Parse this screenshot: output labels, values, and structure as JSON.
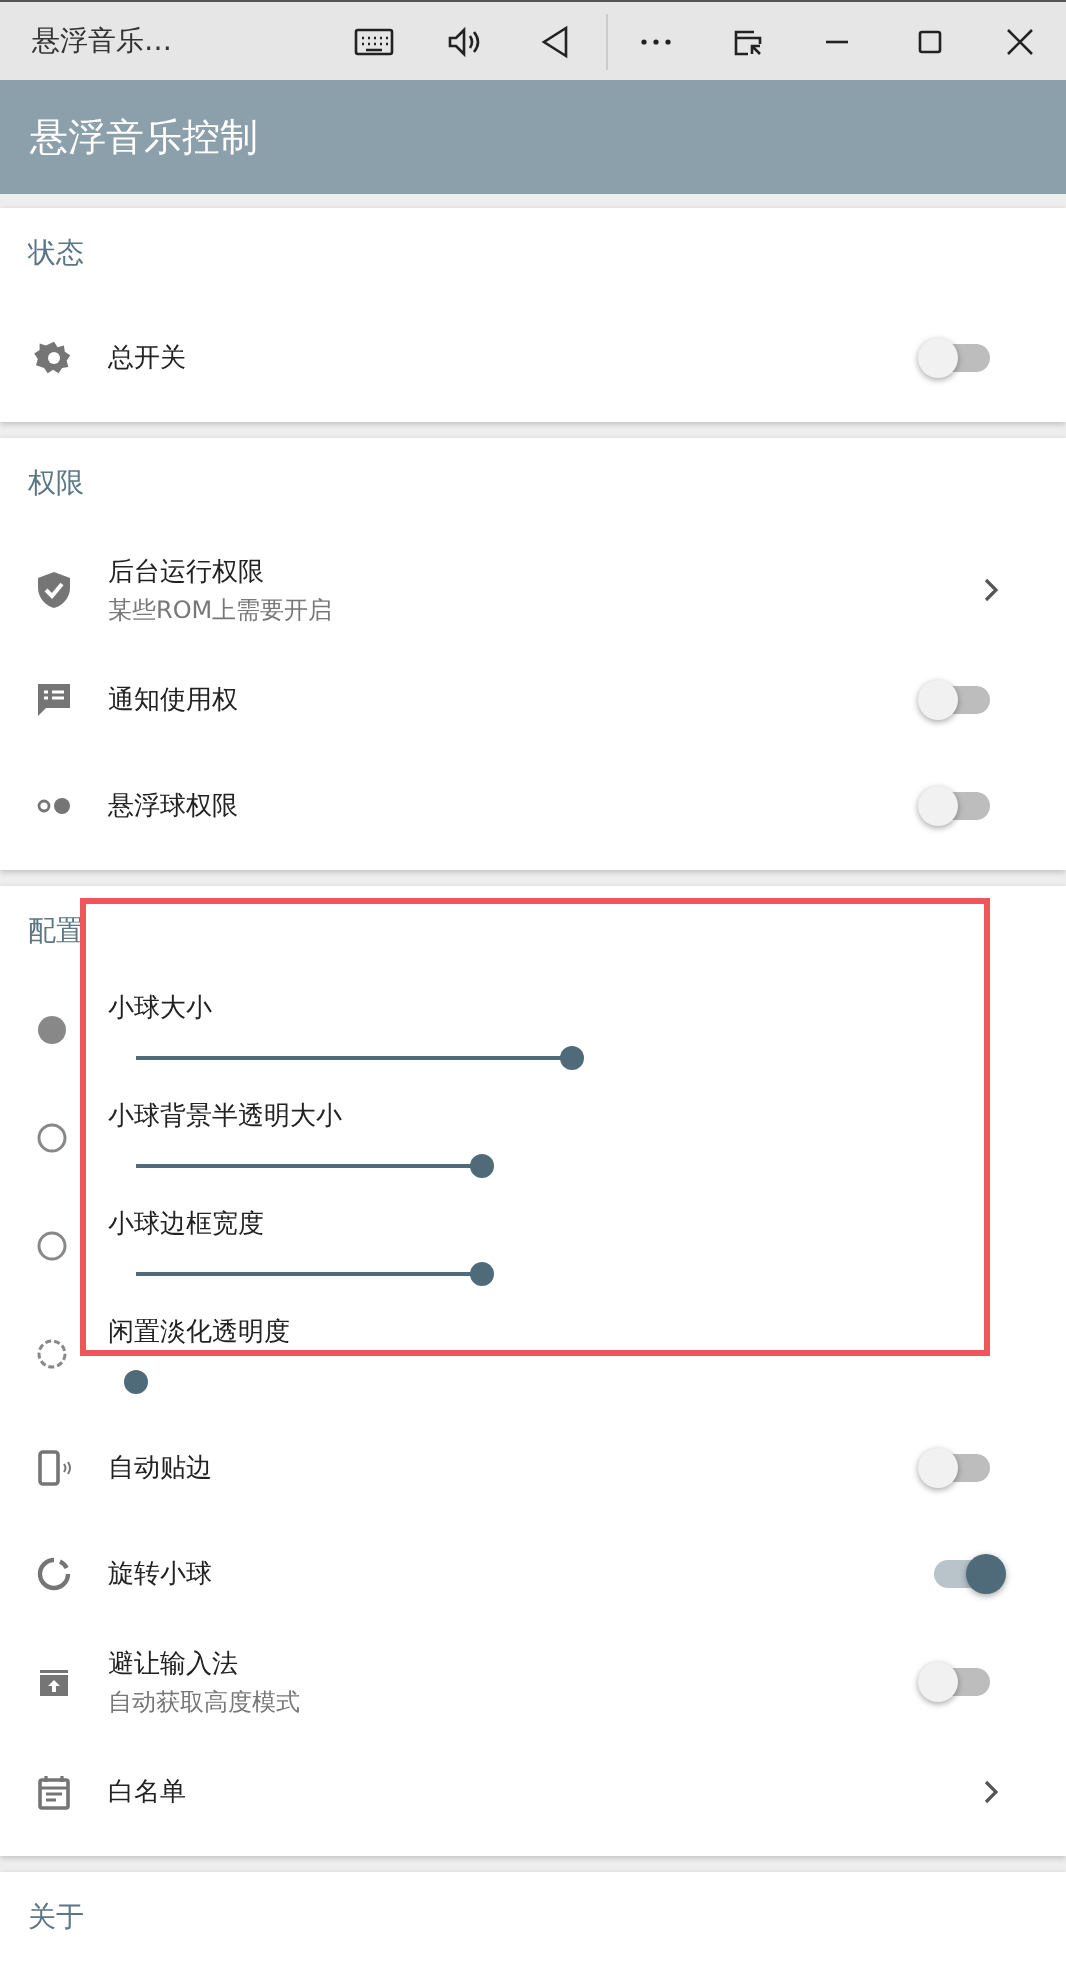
{
  "window": {
    "title": "悬浮音乐…"
  },
  "app_bar": {
    "title": "悬浮音乐控制"
  },
  "sections": [
    {
      "title": "状态",
      "items": [
        {
          "kind": "toggle",
          "label": "总开关",
          "on": false
        }
      ]
    },
    {
      "title": "权限",
      "items": [
        {
          "kind": "link",
          "label": "后台运行权限",
          "subtitle": "某些ROM上需要开启"
        },
        {
          "kind": "toggle",
          "label": "通知使用权",
          "on": false
        },
        {
          "kind": "toggle",
          "label": "悬浮球权限",
          "on": false
        }
      ]
    },
    {
      "title": "配置",
      "highlight": true,
      "items": [
        {
          "kind": "slider",
          "label": "小球大小",
          "level": 0.53
        },
        {
          "kind": "slider",
          "label": "小球背景半透明大小",
          "level": 0.42
        },
        {
          "kind": "slider",
          "label": "小球边框宽度",
          "level": 0.42
        },
        {
          "kind": "slider",
          "label": "闲置淡化透明度",
          "level": 0
        },
        {
          "kind": "toggle",
          "label": "自动贴边",
          "on": false
        },
        {
          "kind": "toggle",
          "label": "旋转小球",
          "on": true
        },
        {
          "kind": "toggle",
          "label": "避让输入法",
          "subtitle": "自动获取高度模式",
          "on": false
        },
        {
          "kind": "link",
          "label": "白名单"
        }
      ]
    },
    {
      "title": "关于"
    }
  ]
}
